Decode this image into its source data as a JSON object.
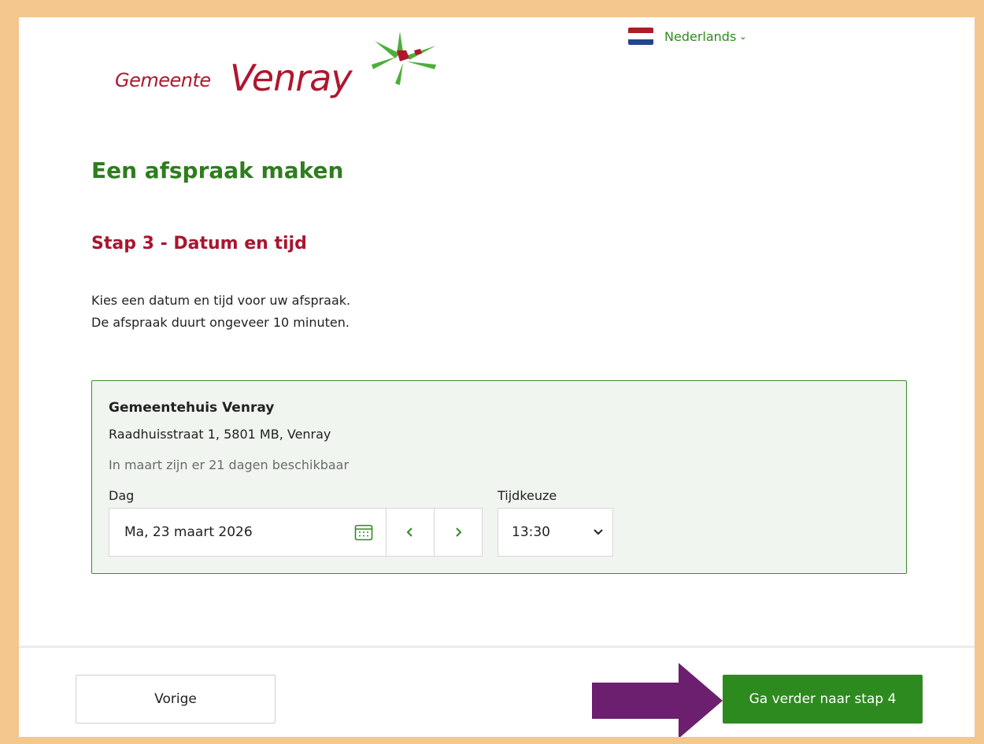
{
  "header": {
    "logo_prefix": "Gemeente",
    "logo_name": "Venray",
    "language": "Nederlands"
  },
  "page": {
    "title": "Een afspraak maken",
    "step_title": "Stap 3 - Datum en tijd",
    "intro_line1": "Kies een datum en tijd voor uw afspraak.",
    "intro_line2": "De afspraak duurt ongeveer 10 minuten."
  },
  "location": {
    "name": "Gemeentehuis Venray",
    "address": "Raadhuisstraat 1, 5801 MB, Venray",
    "availability": "In maart zijn er 21 dagen beschikbaar",
    "day_label": "Dag",
    "day_value": "Ma, 23 maart 2026",
    "time_label": "Tijdkeuze",
    "time_value": "13:30"
  },
  "footer": {
    "back_label": "Vorige",
    "next_label": "Ga verder naar stap 4"
  },
  "colors": {
    "brand_green": "#2d8a1e",
    "brand_red": "#a8162f",
    "annotation_arrow": "#6b1f6e",
    "page_border": "#f4c78f"
  },
  "icons": {
    "language": "netherlands-flag-icon",
    "calendar": "calendar-icon",
    "previous": "chevron-left-icon",
    "next": "chevron-right-icon",
    "select": "chevron-down-icon"
  }
}
